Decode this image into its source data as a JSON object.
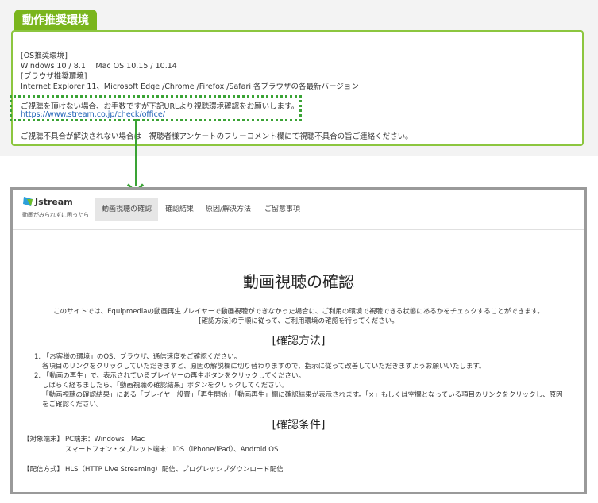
{
  "env_section": {
    "label": "動作推奨環境",
    "os_heading": "[OS推奨環境]",
    "os_value": "Windows 10 / 8.1　 Mac OS 10.15 / 10.14",
    "browser_heading": "[ブラウザ推奨環境]",
    "browser_value": "Internet Explorer 11、Microsoft Edge /Chrome /Firefox /Safari 各ブラウザの各最新バージョン",
    "notice": "ご視聴を頂けない場合、お手数ですが下記URLより視聴環境確認をお願いします。",
    "check_url": "https://www.stream.co.jp/check/office/",
    "contact": "ご視聴不具合が解決されない場合は　視聴者様アンケートのフリーコメント欄にて視聴不具合の旨ご連絡ください。"
  },
  "site": {
    "logo_text": "Jstream",
    "logo_tagline": "動画がみられずに困ったら",
    "nav": [
      {
        "label": "動画視聴の確認",
        "active": true
      },
      {
        "label": "確認結果"
      },
      {
        "label": "原因/解決方法"
      },
      {
        "label": "ご留意事項"
      }
    ]
  },
  "main": {
    "title": "動画視聴の確認",
    "intro": [
      "このサイトでは、Equipmediaの動画再生プレイヤーで動画視聴ができなかった場合に、ご利用の環境で視聴できる状態にあるかをチェックすることができます。",
      "[確認方法]の手順に従って、ご利用環境の確認を行ってください。"
    ],
    "method_title": "[確認方法]",
    "method_lines": [
      "1. 「お客様の環境」のOS、ブラウザ、通信速度をご確認ください。",
      "各項目のリンクをクリックしていただきますと、原因の解説欄に切り替わりますので、指示に従って改善していただきますようお願いいたします。",
      "2. 「動画の再生」で、表示されているプレイヤーの再生ボタンをクリックしてください。",
      "しばらく経ちましたら、「動画視聴の確認結果」ボタンをクリックしてください。",
      "「動画視聴の確認結果」にある「プレイヤー設置」「再生開始」「動画再生」欄に確認結果が表示されます。「×」もしくは空欄となっている項目のリンクをクリックし、原因",
      "をご確認ください。"
    ],
    "conditions_title": "[確認条件]",
    "device_label": "【対象端末】",
    "device_pc": "PC端末：Windows　Mac",
    "device_mobile": "スマートフォン・タブレット端末：iOS（iPhone/iPad）、Android OS",
    "delivery_label": "【配信方式】",
    "delivery_value": "HLS（HTTP Live Streaming）配信、プログレッシブダウンロード配信"
  },
  "colors": {
    "accent_green": "#7ab51d",
    "dotted_green": "#3aa335",
    "link_blue": "#1a5fb4",
    "frame_gray": "#9a9a9a"
  }
}
